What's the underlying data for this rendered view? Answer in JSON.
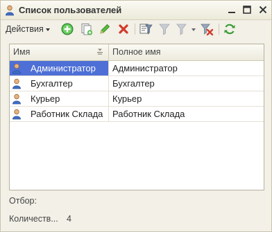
{
  "window": {
    "title": "Список пользователей"
  },
  "toolbar": {
    "actions_label": "Действия"
  },
  "grid": {
    "columns": [
      "Имя",
      "Полное имя"
    ],
    "rows": [
      {
        "name": "Администратор",
        "full_name": "Администратор",
        "selected": true
      },
      {
        "name": "Бухгалтер",
        "full_name": "Бухгалтер",
        "selected": false
      },
      {
        "name": "Курьер",
        "full_name": "Курьер",
        "selected": false
      },
      {
        "name": "Работник Склада",
        "full_name": "Работник Склада",
        "selected": false
      }
    ]
  },
  "footer": {
    "filter_label": "Отбор:",
    "count_label": "Количеств...",
    "count_value": "4"
  },
  "colors": {
    "selection": "#4d6fd6",
    "window_bg": "#f2f0e7"
  },
  "icons": [
    "user-icon",
    "minimize-icon",
    "maximize-icon",
    "close-icon",
    "add-icon",
    "copy-icon",
    "edit-icon",
    "delete-icon",
    "filter-settings-icon",
    "filter-current-icon",
    "filter-list-icon",
    "clear-filter-icon",
    "refresh-icon",
    "sort-icon"
  ]
}
